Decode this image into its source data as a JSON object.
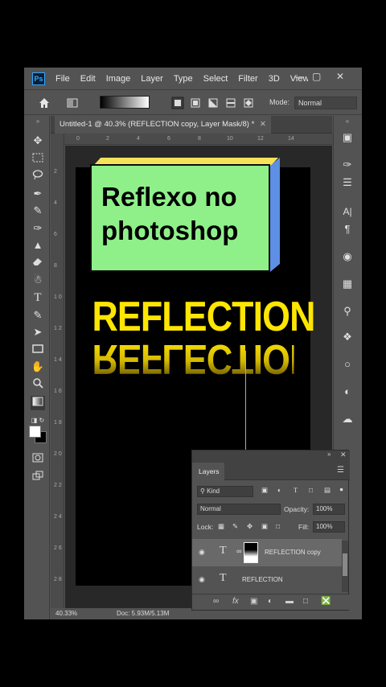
{
  "menubar": {
    "logo": "Ps",
    "items": [
      "File",
      "Edit",
      "Image",
      "Layer",
      "Type",
      "Select",
      "Filter",
      "3D",
      "View"
    ],
    "controls": [
      "—",
      "▢",
      "✕"
    ]
  },
  "options": {
    "mode_label": "Mode:",
    "mode_value": "Normal"
  },
  "document": {
    "tab_title": "Untitled-1 @ 40.3% (REFLECTION copy, Layer Mask/8) *",
    "close": "✕",
    "ruler_h": [
      "0",
      "2",
      "4",
      "6",
      "8",
      "10",
      "12",
      "14"
    ],
    "ruler_v": [
      "2",
      "4",
      "6",
      "8",
      "1 0",
      "1 2",
      "1 4",
      "1 6",
      "1 8",
      "2 0",
      "2 2",
      "2 4",
      "2 6",
      "2 8"
    ]
  },
  "canvas": {
    "text": "REFLECTION",
    "text_color": "#ffe600"
  },
  "banner": {
    "line1": "Reflexo no",
    "line2": "photoshop",
    "face_color": "#8ff08a",
    "top_color": "#f6e25a",
    "side_color": "#5d8fe4"
  },
  "status": {
    "zoom": "40.33%",
    "doc": "Doc: 5.93M/5.13M"
  },
  "layers_panel": {
    "title": "Layers",
    "filter": "Kind",
    "blend_mode": "Normal",
    "opacity_label": "Opacity:",
    "opacity_value": "100%",
    "lock_label": "Lock:",
    "fill_label": "Fill:",
    "fill_value": "100%",
    "layers": [
      {
        "name": "REFLECTION copy",
        "active": true
      },
      {
        "name": "REFLECTION",
        "active": false
      }
    ]
  }
}
